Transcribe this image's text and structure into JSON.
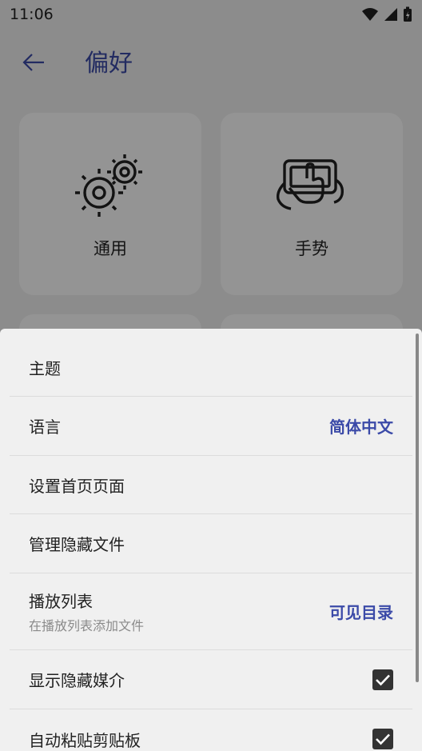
{
  "status_bar": {
    "time": "11:06"
  },
  "header": {
    "title": "偏好"
  },
  "cards": [
    {
      "label": "通用",
      "icon": "gears-icon"
    },
    {
      "label": "手势",
      "icon": "gesture-tablet-icon"
    }
  ],
  "sheet": {
    "rows": [
      {
        "title": "主题"
      },
      {
        "title": "语言",
        "value": "简体中文"
      },
      {
        "title": "设置首页页面"
      },
      {
        "title": "管理隐藏文件"
      },
      {
        "title": "播放列表",
        "subtitle": "在播放列表添加文件",
        "value": "可见目录"
      },
      {
        "title": "显示隐藏媒介",
        "checked": true
      },
      {
        "title": "自动粘贴剪贴板",
        "checked": true
      }
    ]
  },
  "colors": {
    "accent": "#3b4aa8",
    "sheet_bg": "#f0f0f0"
  }
}
